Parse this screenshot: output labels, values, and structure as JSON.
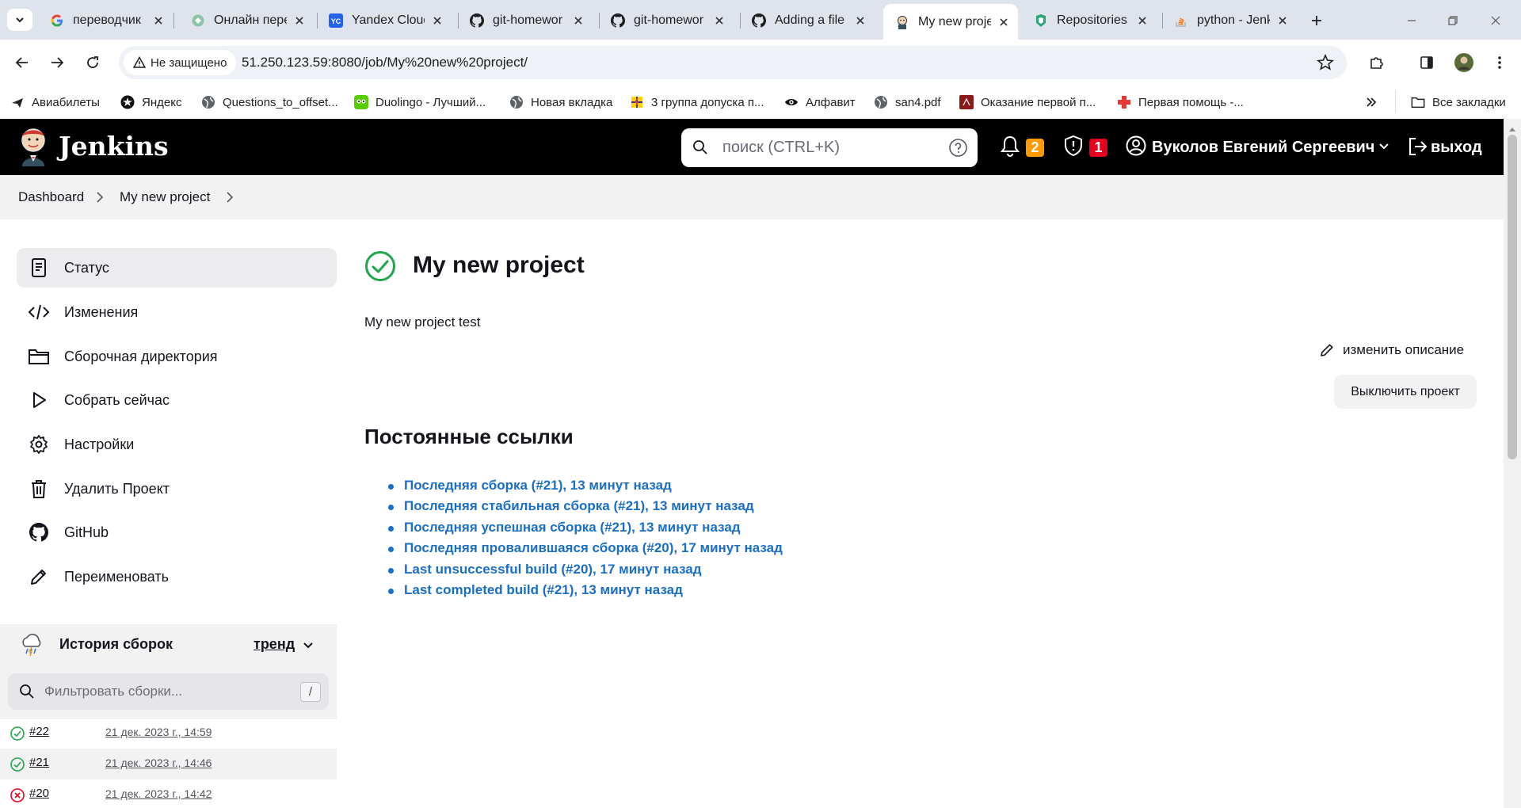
{
  "browser": {
    "tabs": [
      {
        "title": "переводчик",
        "icon": "google-icon"
      },
      {
        "title": "Онлайн пере",
        "icon": "translate-site-icon"
      },
      {
        "title": "Yandex Cloud",
        "icon": "yandex-cloud-icon"
      },
      {
        "title": "git-homewor",
        "icon": "github-icon"
      },
      {
        "title": "git-homewor",
        "icon": "github-icon"
      },
      {
        "title": "Adding a file",
        "icon": "github-icon"
      },
      {
        "title": "My new proje",
        "icon": "jenkins-icon"
      },
      {
        "title": "Repositories",
        "icon": "repo-icon"
      },
      {
        "title": "python - Jenk",
        "icon": "stackoverflow-icon"
      }
    ],
    "active_tab": 6,
    "security_label": "Не защищено",
    "url": "51.250.123.59:8080/job/My%20new%20project/",
    "bookmarks": [
      {
        "label": "Авиабилеты"
      },
      {
        "label": "Яндекс"
      },
      {
        "label": "Questions_to_offset..."
      },
      {
        "label": "Duolingo - Лучший..."
      },
      {
        "label": "Новая вкладка"
      },
      {
        "label": "3 группа допуска п..."
      },
      {
        "label": "Алфавит"
      },
      {
        "label": "san4.pdf"
      },
      {
        "label": "Оказание первой п..."
      },
      {
        "label": "Первая помощь -..."
      }
    ],
    "all_bookmarks_label": "Все закладки"
  },
  "jenkins": {
    "title": "Jenkins",
    "search_placeholder": "поиск (CTRL+K)",
    "notifications_count": "2",
    "security_count": "1",
    "user_name": "Вуколов Евгений Сергеевич",
    "logout_label": "выход",
    "colors": {
      "header_bg": "#000000",
      "link": "#1a6ec7",
      "success": "#1ea64b",
      "failure": "#e6001f",
      "notif_badge": "#fe9a00",
      "security_badge": "#e6001f"
    }
  },
  "breadcrumb": [
    "Dashboard",
    "My new project"
  ],
  "sidebar": {
    "items": [
      {
        "label": "Статус",
        "icon": "notepad-icon"
      },
      {
        "label": "Изменения",
        "icon": "code-icon"
      },
      {
        "label": "Сборочная директория",
        "icon": "folder-icon"
      },
      {
        "label": "Собрать сейчас",
        "icon": "play-icon"
      },
      {
        "label": "Настройки",
        "icon": "gear-icon"
      },
      {
        "label": "Удалить Проект",
        "icon": "trash-icon"
      },
      {
        "label": "GitHub",
        "icon": "github-icon"
      },
      {
        "label": "Переименовать",
        "icon": "pencil-icon"
      }
    ],
    "active_index": 0
  },
  "history": {
    "title": "История сборок",
    "trend_label": "тренд",
    "filter_placeholder": "Фильтровать сборки...",
    "filter_shortcut": "/",
    "builds": [
      {
        "number": "#22",
        "date": "21 дек. 2023 г., 14:59",
        "status": "success"
      },
      {
        "number": "#21",
        "date": "21 дек. 2023 г., 14:46",
        "status": "success"
      },
      {
        "number": "#20",
        "date": "21 дек. 2023 г., 14:42",
        "status": "failure"
      }
    ]
  },
  "main": {
    "project_title": "My new project",
    "description": "My new project test",
    "edit_description_label": "изменить описание",
    "disable_button_label": "Выключить проект",
    "permalinks_title": "Постоянные ссылки",
    "permalinks": [
      "Последняя сборка (#21), 13 минут назад",
      "Последняя стабильная сборка (#21), 13 минут назад",
      "Последняя успешная сборка (#21), 13 минут назад",
      "Последняя провалившаяся сборка (#20), 17 минут назад",
      "Last unsuccessful build (#20), 17 минут назад",
      "Last completed build (#21), 13 минут назад"
    ]
  }
}
